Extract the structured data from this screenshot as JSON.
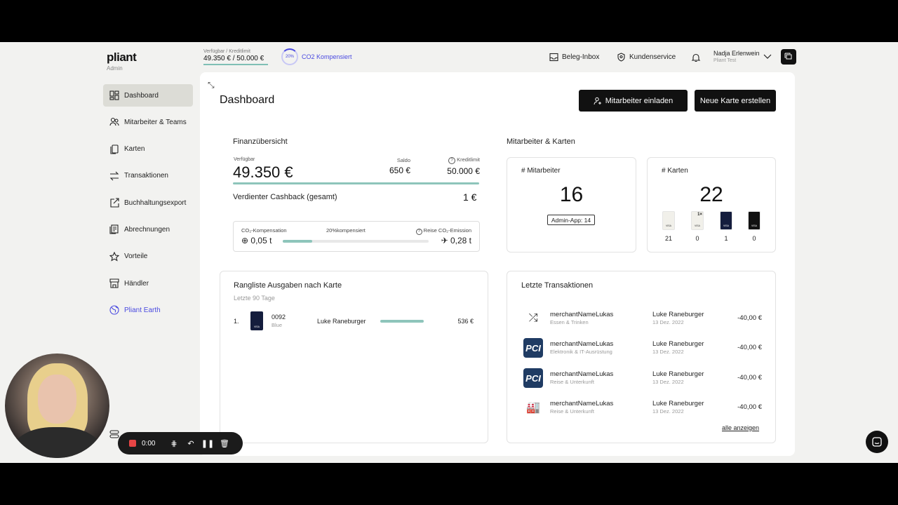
{
  "app": {
    "brand": "pliant",
    "role": "Admin"
  },
  "topbar": {
    "credit_label": "Verfügbar / Kreditlimit",
    "credit_value": "49.350 € / 50.000 €",
    "co2_ring": "20%",
    "co2_label": "CO2 Kompensiert",
    "receipt_inbox": "Beleg-Inbox",
    "support": "Kundenservice",
    "user_name": "Nadja Erlenwein",
    "user_org": "Pliant Test"
  },
  "sidebar": {
    "items": [
      {
        "label": "Dashboard",
        "icon": "dashboard-icon"
      },
      {
        "label": "Mitarbeiter & Teams",
        "icon": "users-icon"
      },
      {
        "label": "Karten",
        "icon": "cards-icon"
      },
      {
        "label": "Transaktionen",
        "icon": "transactions-icon"
      },
      {
        "label": "Buchhaltungsexport",
        "icon": "export-icon"
      },
      {
        "label": "Abrechnungen",
        "icon": "statements-icon"
      },
      {
        "label": "Vorteile",
        "icon": "star-icon"
      },
      {
        "label": "Händler",
        "icon": "store-icon"
      },
      {
        "label": "Pliant Earth",
        "icon": "globe-icon"
      }
    ]
  },
  "page": {
    "title": "Dashboard",
    "invite_button": "Mitarbeiter einladen",
    "new_card_button": "Neue Karte erstellen"
  },
  "finance": {
    "title": "Finanzübersicht",
    "available_label": "Verfügbar",
    "available_value": "49.350 €",
    "balance_label": "Saldo",
    "balance_value": "650 €",
    "limit_label": "Kreditlimit",
    "limit_value": "50.000 €",
    "cashback_label": "Verdienter Cashback (gesamt)",
    "cashback_value": "1 €",
    "co2_comp_label": "CO₂-Kompensation",
    "co2_percent_label": "20%kompensiert",
    "co2_travel_label": "Reise CO₂-Emission",
    "co2_comp_value": "0,05 t",
    "co2_travel_value": "0,28 t",
    "co2_progress": 0.2
  },
  "employees_cards": {
    "title": "Mitarbeiter & Karten",
    "employees_label": "# Mitarbeiter",
    "employees_value": "16",
    "admin_app": "Admin-App: 14",
    "cards_label": "# Karten",
    "cards_value": "22",
    "card_types": [
      {
        "count": "21",
        "color": "#f1f0ea",
        "badge": ""
      },
      {
        "count": "0",
        "color": "#f1f0ea",
        "badge": "1×"
      },
      {
        "count": "1",
        "color": "#141d3d",
        "badge": ""
      },
      {
        "count": "0",
        "color": "#111111",
        "badge": ""
      }
    ],
    "visa": "VISA"
  },
  "ranking": {
    "title": "Rangliste Ausgaben nach Karte",
    "subtitle": "Letzte 90 Tage",
    "rows": [
      {
        "rank": "1.",
        "card_no": "0092",
        "card_name": "Blue",
        "holder": "Luke Raneburger",
        "amount": "536 €"
      }
    ]
  },
  "transactions": {
    "title": "Letzte Transaktionen",
    "show_all": "alle anzeigen",
    "rows": [
      {
        "merchant": "merchantNameLukas",
        "category": "Essen & Trinken",
        "holder": "Luke Raneburger",
        "date": "13 Dez. 2022",
        "amount": "-40,00 €",
        "logo": "shuffle-icon"
      },
      {
        "merchant": "merchantNameLukas",
        "category": "Elektronik & IT-Ausrüstung",
        "holder": "Luke Raneburger",
        "date": "13 Dez. 2022",
        "amount": "-40,00 €",
        "logo": "PCI"
      },
      {
        "merchant": "merchantNameLukas",
        "category": "Reise & Unterkunft",
        "holder": "Luke Raneburger",
        "date": "13 Dez. 2022",
        "amount": "-40,00 €",
        "logo": "PCI"
      },
      {
        "merchant": "merchantNameLukas",
        "category": "Reise & Unterkunft",
        "holder": "Luke Raneburger",
        "date": "13 Dez. 2022",
        "amount": "-40,00 €",
        "logo": "factory-icon"
      }
    ]
  },
  "recorder": {
    "time": "0:00"
  }
}
